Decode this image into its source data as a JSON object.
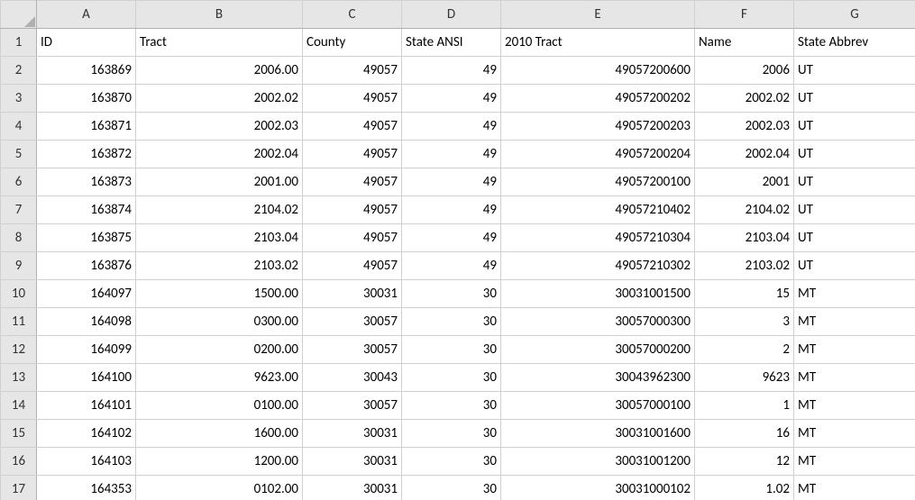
{
  "columnLetters": [
    "A",
    "B",
    "C",
    "D",
    "E",
    "F",
    "G"
  ],
  "rowNumbers": [
    "1",
    "2",
    "3",
    "4",
    "5",
    "6",
    "7",
    "8",
    "9",
    "10",
    "11",
    "12",
    "13",
    "14",
    "15",
    "16",
    "17"
  ],
  "headerRow": [
    "ID",
    "Tract",
    "County",
    "State ANSI",
    "2010 Tract",
    "Name",
    "State Abbrev"
  ],
  "headerAlign": [
    "left",
    "left",
    "left",
    "left",
    "left",
    "left",
    "left"
  ],
  "dataAlign": [
    "right",
    "right",
    "right",
    "right",
    "right",
    "right",
    "left"
  ],
  "rows": [
    [
      "163869",
      "2006.00",
      "49057",
      "49",
      "49057200600",
      "2006",
      "UT"
    ],
    [
      "163870",
      "2002.02",
      "49057",
      "49",
      "49057200202",
      "2002.02",
      "UT"
    ],
    [
      "163871",
      "2002.03",
      "49057",
      "49",
      "49057200203",
      "2002.03",
      "UT"
    ],
    [
      "163872",
      "2002.04",
      "49057",
      "49",
      "49057200204",
      "2002.04",
      "UT"
    ],
    [
      "163873",
      "2001.00",
      "49057",
      "49",
      "49057200100",
      "2001",
      "UT"
    ],
    [
      "163874",
      "2104.02",
      "49057",
      "49",
      "49057210402",
      "2104.02",
      "UT"
    ],
    [
      "163875",
      "2103.04",
      "49057",
      "49",
      "49057210304",
      "2103.04",
      "UT"
    ],
    [
      "163876",
      "2103.02",
      "49057",
      "49",
      "49057210302",
      "2103.02",
      "UT"
    ],
    [
      "164097",
      "1500.00",
      "30031",
      "30",
      "30031001500",
      "15",
      "MT"
    ],
    [
      "164098",
      "0300.00",
      "30057",
      "30",
      "30057000300",
      "3",
      "MT"
    ],
    [
      "164099",
      "0200.00",
      "30057",
      "30",
      "30057000200",
      "2",
      "MT"
    ],
    [
      "164100",
      "9623.00",
      "30043",
      "30",
      "30043962300",
      "9623",
      "MT"
    ],
    [
      "164101",
      "0100.00",
      "30057",
      "30",
      "30057000100",
      "1",
      "MT"
    ],
    [
      "164102",
      "1600.00",
      "30031",
      "30",
      "30031001600",
      "16",
      "MT"
    ],
    [
      "164103",
      "1200.00",
      "30031",
      "30",
      "30031001200",
      "12",
      "MT"
    ],
    [
      "164353",
      "0102.00",
      "30031",
      "30",
      "30031000102",
      "1.02",
      "MT"
    ]
  ]
}
